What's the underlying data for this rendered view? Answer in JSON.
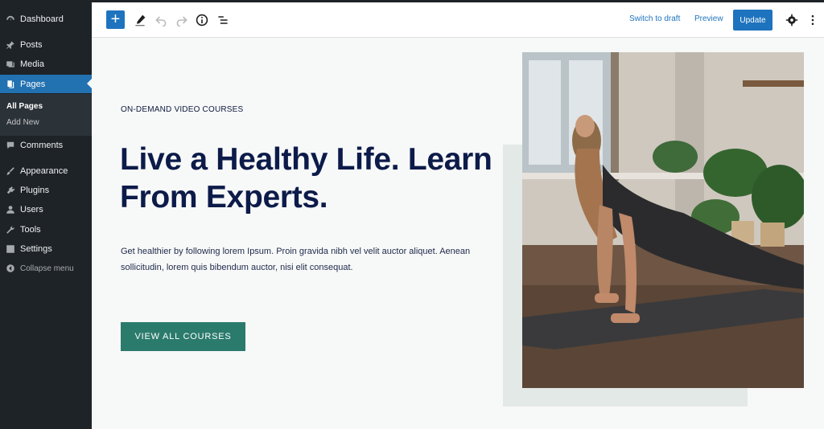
{
  "sidebar": {
    "items": [
      {
        "label": "Dashboard",
        "icon": "dashboard-icon"
      },
      {
        "label": "Posts",
        "icon": "pin-icon"
      },
      {
        "label": "Media",
        "icon": "media-icon"
      },
      {
        "label": "Pages",
        "icon": "pages-icon"
      },
      {
        "label": "Comments",
        "icon": "comment-icon"
      },
      {
        "label": "Appearance",
        "icon": "brush-icon"
      },
      {
        "label": "Plugins",
        "icon": "plugin-icon"
      },
      {
        "label": "Users",
        "icon": "user-icon"
      },
      {
        "label": "Tools",
        "icon": "wrench-icon"
      },
      {
        "label": "Settings",
        "icon": "settings-icon"
      }
    ],
    "submenu": {
      "all_pages": "All Pages",
      "add_new": "Add New"
    },
    "collapse_label": "Collapse menu"
  },
  "toolbar": {
    "add_label": "+",
    "switch_label": "Switch to draft",
    "preview_label": "Preview",
    "update_label": "Update"
  },
  "hero": {
    "eyebrow": "ON-DEMAND VIDEO COURSES",
    "headline_line1": "Live a Healthy Life. Learn",
    "headline_line2": "From Experts.",
    "body": "Get healthier by following lorem Ipsum. Proin gravida nibh vel velit auctor aliquet. Aenean sollicitudin, lorem quis bibendum auctor, nisi elit consequat.",
    "cta_label": "VIEW ALL COURSES"
  },
  "colors": {
    "accent": "#1e73be",
    "sidebar_bg": "#1d2327",
    "headline": "#0c1b49",
    "cta": "#2b7b6c",
    "block": "#e3e9e6"
  }
}
